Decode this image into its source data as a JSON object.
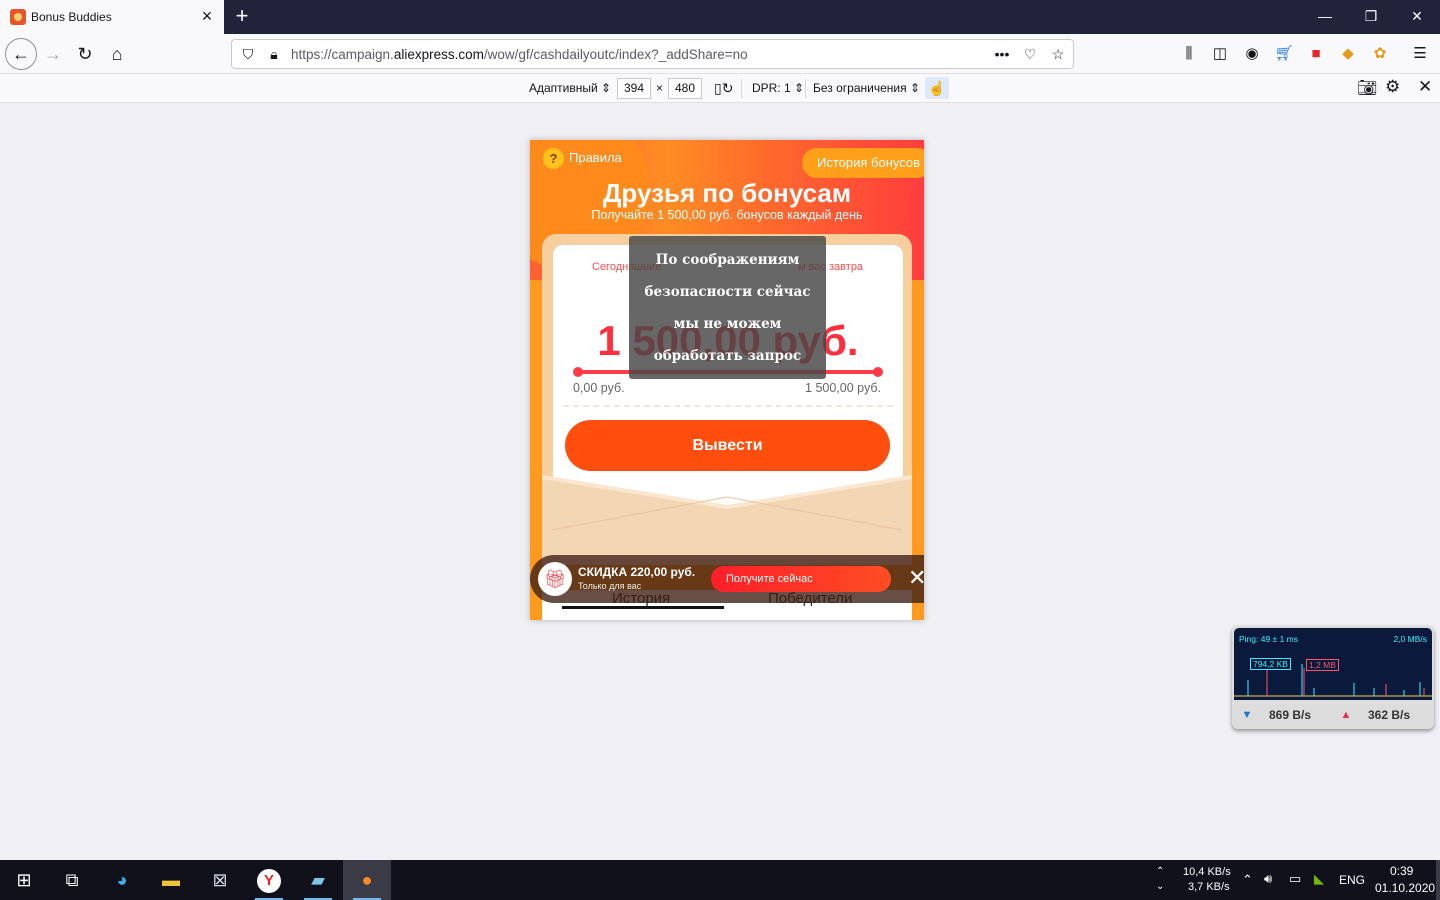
{
  "browser": {
    "tab_title": "Bonus Buddies",
    "url_prefix": "https://campaign.",
    "url_domain": "aliexpress.com",
    "url_suffix": "/wow/gf/cashdailyoutc/index?_addShare=no",
    "window_controls": {
      "minimize": "—",
      "restore": "❐",
      "close": "✕"
    }
  },
  "rdm": {
    "device": "Адаптивный",
    "width": "394",
    "x_sep": "×",
    "height": "480",
    "dpr": "DPR: 1",
    "throttle": "Без ограничения"
  },
  "page": {
    "rules_icon": "?",
    "rules_label": "Правила",
    "history_button": "История бонусов",
    "title": "Друзья по бонусам",
    "subtitle": "Получайте 1 500,00 руб. бонусов каждый день",
    "card_caption": "Сегодняшние бонусы ... м вас завтра",
    "card_caption_left": "Сегодняшние",
    "card_caption_right": "м вас завтра",
    "amount": "1 500,00 руб.",
    "min_label": "0,00 руб.",
    "max_label": "1 500,00 руб.",
    "progress": 1.0,
    "withdraw_button": "Вывести",
    "overlay_lines": [
      "По соображениям",
      "безопасности сейчас",
      "мы не можем",
      "обработать запрос"
    ],
    "coupon_title": "СКИДКА 220,00 руб.",
    "coupon_sub": "Только для вас",
    "coupon_button": "Получите сейчас",
    "tab_history": "История",
    "tab_winners": "Победители"
  },
  "netmeter": {
    "ping": "Ping: 49 ± 1 ms",
    "max": "2,0 MB/s",
    "dl_peak": "794,2 KB",
    "ul_peak": "1,2 MB",
    "dl_rate": "869 B/s",
    "ul_rate": "362 B/s"
  },
  "taskbar": {
    "net_up": "10,4 KB/s",
    "net_down": "3,7 KB/s",
    "lang": "ENG",
    "time": "0:39",
    "date": "01.10.2020"
  },
  "colors": {
    "accent": "#ff4e0e",
    "amount": "#ff2f3e",
    "tabstrip": "#20233a"
  }
}
